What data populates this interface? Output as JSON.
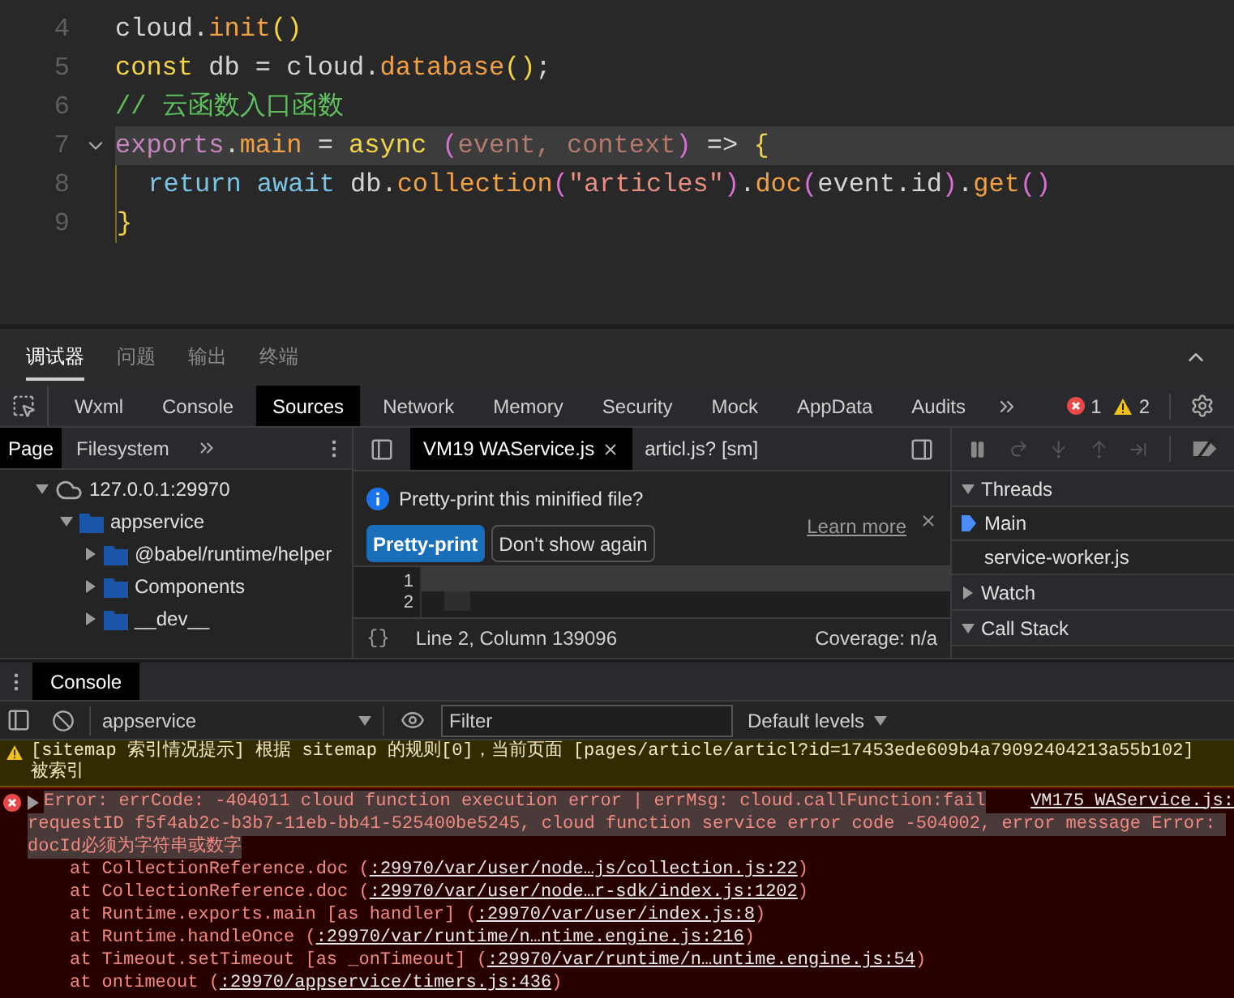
{
  "editor": {
    "lines": [
      {
        "number": "4",
        "current": false,
        "fold": false,
        "guide": false,
        "tokens": [
          {
            "text": "cloud.",
            "kind": "plain"
          },
          {
            "text": "init",
            "kind": "method"
          },
          {
            "text": "()",
            "kind": "bracket"
          }
        ]
      },
      {
        "number": "5",
        "current": false,
        "fold": false,
        "guide": false,
        "tokens": [
          {
            "text": "const",
            "kind": "storage"
          },
          {
            "text": " db = cloud.",
            "kind": "plain"
          },
          {
            "text": "database",
            "kind": "method"
          },
          {
            "text": "()",
            "kind": "bracket"
          },
          {
            "text": ";",
            "kind": "plain"
          }
        ]
      },
      {
        "number": "6",
        "current": false,
        "fold": false,
        "guide": false,
        "tokens": [
          {
            "text": "// 云函数入口函数",
            "kind": "comment"
          }
        ]
      },
      {
        "number": "7",
        "current": true,
        "fold": true,
        "guide": false,
        "tokens": [
          {
            "text": "exports",
            "kind": "object"
          },
          {
            "text": ".",
            "kind": "plain"
          },
          {
            "text": "main",
            "kind": "method"
          },
          {
            "text": " = ",
            "kind": "plain"
          },
          {
            "text": "async",
            "kind": "storage"
          },
          {
            "text": " (",
            "kind": "bracket2"
          },
          {
            "text": "event, context",
            "kind": "param"
          },
          {
            "text": ")",
            "kind": "bracket2"
          },
          {
            "text": " => ",
            "kind": "plain"
          },
          {
            "text": "{",
            "kind": "bracket"
          }
        ]
      },
      {
        "number": "8",
        "current": false,
        "fold": false,
        "guide": true,
        "tokens": [
          {
            "text": "  return await",
            "kind": "keyword"
          },
          {
            "text": " db.",
            "kind": "plain"
          },
          {
            "text": "collection",
            "kind": "method"
          },
          {
            "text": "(",
            "kind": "bracket2"
          },
          {
            "text": "\"articles\"",
            "kind": "string"
          },
          {
            "text": ")",
            "kind": "bracket2"
          },
          {
            "text": ".",
            "kind": "plain"
          },
          {
            "text": "doc",
            "kind": "method"
          },
          {
            "text": "(",
            "kind": "bracket2"
          },
          {
            "text": "event.id",
            "kind": "plain"
          },
          {
            "text": ")",
            "kind": "bracket2"
          },
          {
            "text": ".",
            "kind": "plain"
          },
          {
            "text": "get",
            "kind": "method"
          },
          {
            "text": "()",
            "kind": "bracket2"
          }
        ]
      },
      {
        "number": "9",
        "current": false,
        "fold": false,
        "guide": true,
        "tokens": [
          {
            "text": "}",
            "kind": "bracket"
          }
        ]
      }
    ]
  },
  "panel_tabs": [
    {
      "label": "调试器",
      "selected": true
    },
    {
      "label": "问题",
      "selected": false
    },
    {
      "label": "输出",
      "selected": false
    },
    {
      "label": "终端",
      "selected": false
    }
  ],
  "devtools_tabs": [
    {
      "label": "Wxml",
      "selected": false
    },
    {
      "label": "Console",
      "selected": false
    },
    {
      "label": "Sources",
      "selected": true
    },
    {
      "label": "Network",
      "selected": false
    },
    {
      "label": "Memory",
      "selected": false
    },
    {
      "label": "Security",
      "selected": false
    },
    {
      "label": "Mock",
      "selected": false
    },
    {
      "label": "AppData",
      "selected": false
    },
    {
      "label": "Audits",
      "selected": false
    }
  ],
  "issue_counts": {
    "errors": "1",
    "warnings": "2"
  },
  "navigator": {
    "tabs": [
      {
        "label": "Page",
        "selected": true
      },
      {
        "label": "Filesystem",
        "selected": false
      }
    ],
    "tree": [
      {
        "label": "127.0.0.1:29970",
        "kind": "origin",
        "expanded": true,
        "children": [
          {
            "label": "appservice",
            "kind": "folder",
            "expanded": true,
            "children": [
              {
                "label": "@babel/runtime/helper",
                "kind": "folder",
                "expanded": false
              },
              {
                "label": "Components",
                "kind": "folder",
                "expanded": false
              },
              {
                "label": "__dev__",
                "kind": "folder",
                "expanded": false
              }
            ]
          }
        ]
      }
    ]
  },
  "editor_tabs": [
    {
      "label": "VM19 WAService.js",
      "selected": true,
      "closable": true
    },
    {
      "label": "articl.js? [sm]",
      "selected": false,
      "closable": false
    }
  ],
  "infobar": {
    "message": "Pretty-print this minified file?",
    "link": "Learn more",
    "buttons": [
      {
        "label": "Pretty-print",
        "primary": true
      },
      {
        "label": "Don't show again",
        "primary": false
      }
    ]
  },
  "gutter": [
    "1",
    "2"
  ],
  "status": {
    "format": "{}",
    "position": "Line 2, Column 139096",
    "coverage": "Coverage: n/a"
  },
  "debugger": {
    "sections": [
      {
        "title": "Threads",
        "expanded": true,
        "items": [
          {
            "label": "Main",
            "selected": true
          },
          {
            "label": "service-worker.js",
            "selected": false
          }
        ]
      },
      {
        "title": "Watch",
        "expanded": false
      },
      {
        "title": "Call Stack",
        "expanded": true
      }
    ]
  },
  "drawer": {
    "tabs": [
      {
        "label": "Console",
        "selected": true
      }
    ]
  },
  "console_toolbar": {
    "context": "appservice",
    "filter_placeholder": "Filter",
    "levels": "Default levels"
  },
  "messages": [
    {
      "kind": "warning",
      "lines": [
        "[sitemap 索引情况提示] 根据 sitemap 的规则[0]，当前页面 [pages/article/articl?id=17453ede609b4a79092404213a55b102]",
        "被索引"
      ]
    },
    {
      "kind": "error",
      "expanded": false,
      "source": "VM175 WAService.js:",
      "lines": [
        "Error: errCode: -404011 cloud function execution error | errMsg: cloud.callFunction:fail",
        "requestID f5f4ab2c-b3b7-11eb-bb41-525400be5245, cloud function service error code -504002, error message Error: ",
        "docId必须为字符串或数字"
      ],
      "stack": [
        {
          "text": "at CollectionReference.doc (",
          "link": ":29970/var/user/node…js/collection.js:22",
          "suffix": ")"
        },
        {
          "text": "at CollectionReference.doc (",
          "link": ":29970/var/user/node…r-sdk/index.js:1202",
          "suffix": ")"
        },
        {
          "text": "at Runtime.exports.main [as handler] (",
          "link": ":29970/var/user/index.js:8",
          "suffix": ")"
        },
        {
          "text": "at Runtime.handleOnce (",
          "link": ":29970/var/runtime/n…ntime.engine.js:216",
          "suffix": ")"
        },
        {
          "text": "at Timeout.setTimeout [as _onTimeout] (",
          "link": ":29970/var/runtime/n…untime.engine.js:54",
          "suffix": ")"
        },
        {
          "text": "at ontimeout (",
          "link": ":29970/appservice/timers.js:436",
          "suffix": ")"
        }
      ]
    }
  ]
}
